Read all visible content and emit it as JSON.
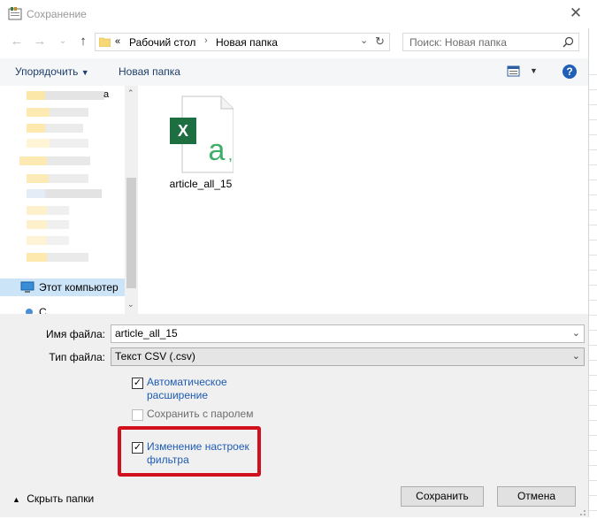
{
  "window": {
    "title": "Сохранение"
  },
  "address": {
    "overflow": "«",
    "crumbs": [
      "Рабочий стол",
      "Новая папка"
    ]
  },
  "search": {
    "placeholder": "Поиск: Новая папка"
  },
  "toolbar": {
    "organize": "Упорядочить",
    "new_folder": "Новая папка"
  },
  "sidebar": {
    "items": [
      {
        "label": "Этот компьютер",
        "icon": "computer-icon"
      },
      {
        "label": "С",
        "icon": "network-icon"
      }
    ]
  },
  "files": [
    {
      "name": "article_all_15",
      "icon": "excel-csv-file-icon"
    }
  ],
  "form": {
    "filename_label": "Имя файла:",
    "filename_value": "article_all_15",
    "filetype_label": "Тип файла:",
    "filetype_value": "Текст CSV (.csv)"
  },
  "options": {
    "auto_ext_line1": "Автоматическое",
    "auto_ext_line2": "расширение",
    "auto_ext_checked": true,
    "password_label": "Сохранить с паролем",
    "password_checked": false,
    "filter_line1": "Изменение настроек",
    "filter_line2": "фильтра",
    "filter_checked": true
  },
  "footer": {
    "hide_folders": "Скрыть папки",
    "save": "Сохранить",
    "cancel": "Отмена"
  },
  "colors": {
    "highlight": "#d20f1d",
    "link": "#1e5cb3",
    "excel_green": "#1d6f42"
  }
}
